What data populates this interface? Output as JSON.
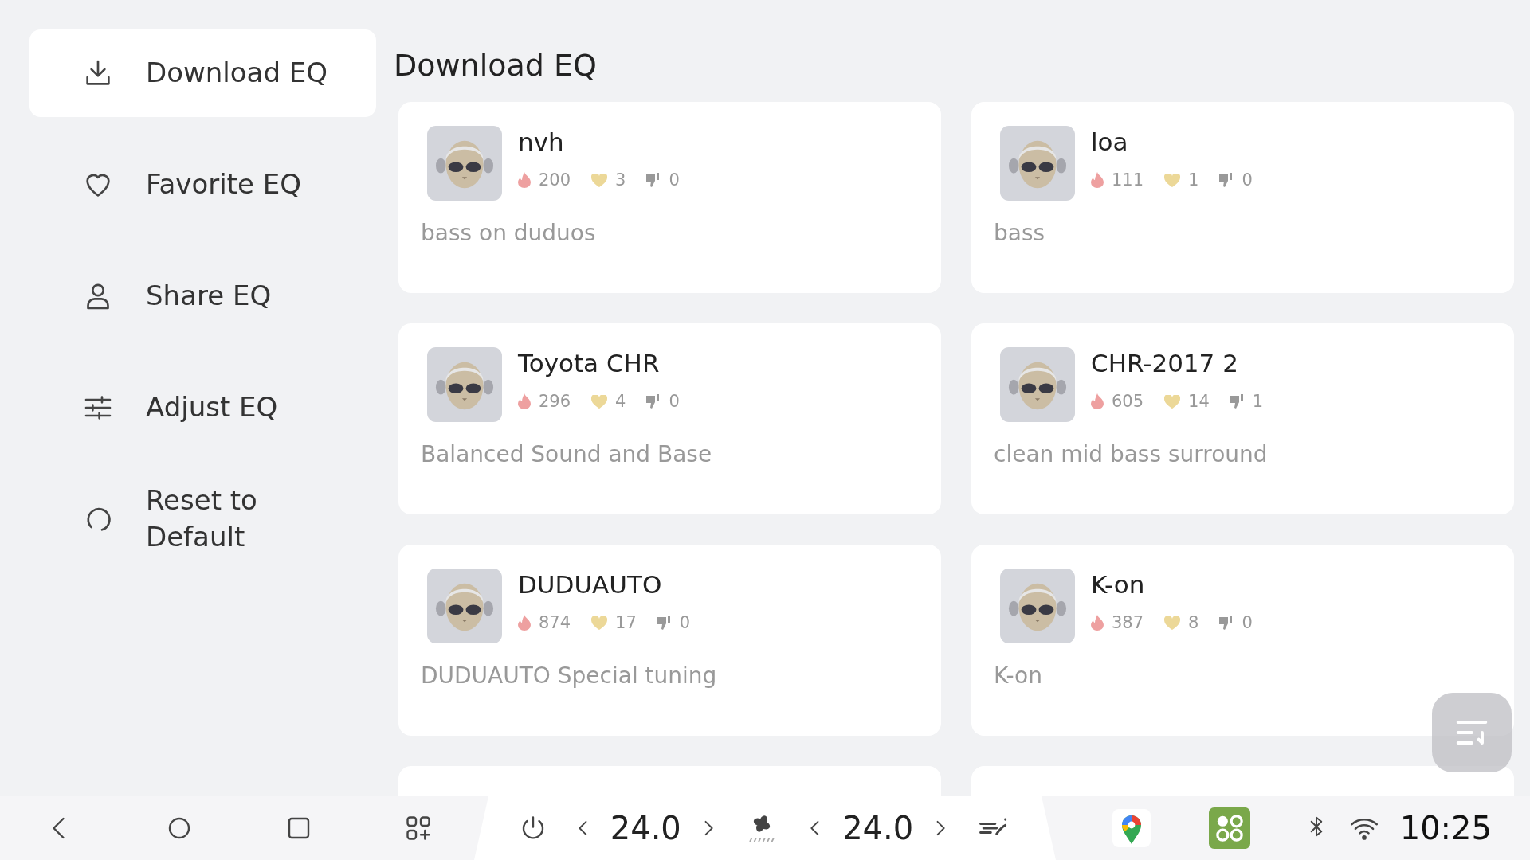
{
  "sidebar": {
    "items": [
      {
        "kind": "download",
        "label": "Download EQ",
        "selected": true
      },
      {
        "kind": "heart",
        "label": "Favorite EQ",
        "selected": false
      },
      {
        "kind": "person",
        "label": "Share EQ",
        "selected": false
      },
      {
        "kind": "sliders",
        "label": "Adjust EQ",
        "selected": false
      },
      {
        "kind": "reset",
        "label": "Reset to Default",
        "selected": false
      }
    ]
  },
  "page_title": "Download EQ",
  "cards": [
    {
      "name": "nvh",
      "heat": "200",
      "likes": "3",
      "dislikes": "0",
      "description": "bass on duduos"
    },
    {
      "name": "loa",
      "heat": "111",
      "likes": "1",
      "dislikes": "0",
      "description": "bass"
    },
    {
      "name": "Toyota CHR",
      "heat": "296",
      "likes": "4",
      "dislikes": "0",
      "description": "Balanced Sound and Base"
    },
    {
      "name": "CHR-2017 2",
      "heat": "605",
      "likes": "14",
      "dislikes": "1",
      "description": "clean mid bass surround"
    },
    {
      "name": "DUDUAUTO",
      "heat": "874",
      "likes": "17",
      "dislikes": "0",
      "description": "DUDUAUTO Special tuning"
    },
    {
      "name": "K-on",
      "heat": "387",
      "likes": "8",
      "dislikes": "0",
      "description": "K-on"
    }
  ],
  "status_bar": {
    "driver_temp": "24.0",
    "passenger_temp": "24.0",
    "time": "10:25"
  }
}
